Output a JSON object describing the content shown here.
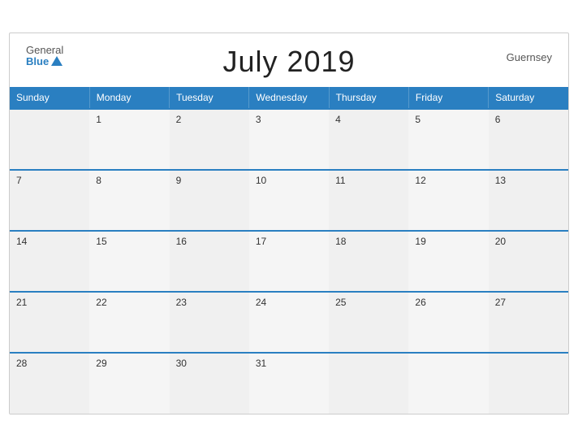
{
  "header": {
    "title": "July 2019",
    "region": "Guernsey",
    "logo_general": "General",
    "logo_blue": "Blue"
  },
  "weekdays": [
    "Sunday",
    "Monday",
    "Tuesday",
    "Wednesday",
    "Thursday",
    "Friday",
    "Saturday"
  ],
  "weeks": [
    [
      "",
      "1",
      "2",
      "3",
      "4",
      "5",
      "6"
    ],
    [
      "7",
      "8",
      "9",
      "10",
      "11",
      "12",
      "13"
    ],
    [
      "14",
      "15",
      "16",
      "17",
      "18",
      "19",
      "20"
    ],
    [
      "21",
      "22",
      "23",
      "24",
      "25",
      "26",
      "27"
    ],
    [
      "28",
      "29",
      "30",
      "31",
      "",
      "",
      ""
    ]
  ]
}
